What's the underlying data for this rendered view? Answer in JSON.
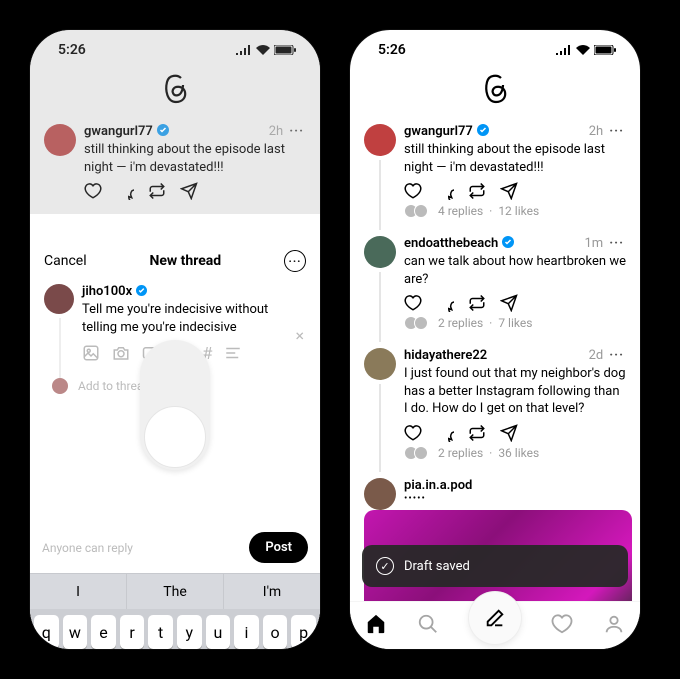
{
  "status": {
    "time": "5:26"
  },
  "phone1": {
    "bg_post": {
      "username": "gwangurl77",
      "time": "2h",
      "text": "still thinking about the episode last night — i'm devastated!!!"
    },
    "composer": {
      "cancel": "Cancel",
      "title": "New thread",
      "username": "jiho100x",
      "text": "Tell me you're indecisive without telling me you're indecisive",
      "add_placeholder": "Add to thread",
      "audience": "Anyone can reply",
      "post_btn": "Post"
    },
    "kbd_suggest": [
      "I",
      "The",
      "I'm"
    ],
    "kbd_row": [
      "q",
      "w",
      "e",
      "r",
      "t",
      "y",
      "u",
      "i",
      "o",
      "p"
    ]
  },
  "phone2": {
    "posts": [
      {
        "username": "gwangurl77",
        "verified": true,
        "time": "2h",
        "text": "still thinking about the episode last night — i'm devastated!!!",
        "replies": "4 replies",
        "likes": "12 likes"
      },
      {
        "username": "endoatthebeach",
        "verified": true,
        "time": "1m",
        "text": "can we talk about how heartbroken we are?",
        "replies": "2 replies",
        "likes": "7 likes"
      },
      {
        "username": "hidayathere22",
        "verified": false,
        "time": "2d",
        "text": "I just found out that my neighbor's dog has a better Instagram following than I do. How do I get on that level?",
        "replies": "2 replies",
        "likes": "36 likes"
      },
      {
        "username": "pia.in.a.pod",
        "verified": false,
        "time": "",
        "text": "",
        "has_image": true,
        "dots": "•••••"
      }
    ],
    "toast": "Draft saved"
  },
  "colors": {
    "verified": "#0095f6",
    "av1": "#c04040",
    "av2": "#4a6a5a",
    "av3": "#8a7a5a",
    "av4": "#7a5a4a"
  }
}
